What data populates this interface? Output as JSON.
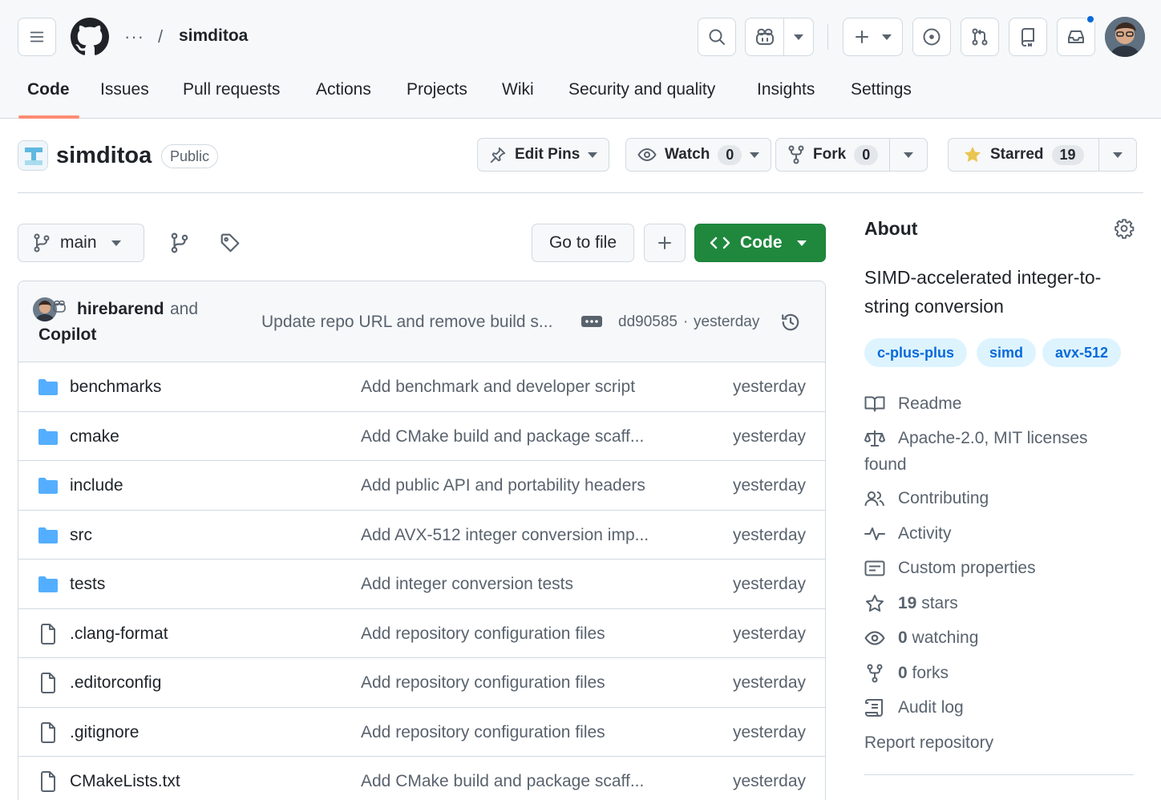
{
  "header": {
    "breadcrumb_dots": "···",
    "separator": "/",
    "repo_name": "simditoa"
  },
  "nav": {
    "tabs": [
      {
        "label": "Code"
      },
      {
        "label": "Issues"
      },
      {
        "label": "Pull requests"
      },
      {
        "label": "Actions"
      },
      {
        "label": "Projects"
      },
      {
        "label": "Wiki"
      },
      {
        "label": "Security and quality"
      },
      {
        "label": "Insights"
      },
      {
        "label": "Settings"
      }
    ]
  },
  "repo": {
    "name": "simditoa",
    "visibility": "Public",
    "edit_pins": "Edit Pins",
    "watch_label": "Watch",
    "watch_count": "0",
    "fork_label": "Fork",
    "fork_count": "0",
    "star_label": "Starred",
    "star_count": "19"
  },
  "toolbar": {
    "branch": "main",
    "go_to_file": "Go to file",
    "add": "+",
    "code": "Code"
  },
  "commit": {
    "author": "hirebarend",
    "and": "and",
    "coauthor": "Copilot",
    "message": "Update repo URL and remove build s...",
    "hash": "dd90585",
    "dot": "·",
    "time": "yesterday"
  },
  "files": [
    {
      "type": "folder",
      "name": "benchmarks",
      "message": "Add benchmark and developer script",
      "time": "yesterday"
    },
    {
      "type": "folder",
      "name": "cmake",
      "message": "Add CMake build and package scaff...",
      "time": "yesterday"
    },
    {
      "type": "folder",
      "name": "include",
      "message": "Add public API and portability headers",
      "time": "yesterday"
    },
    {
      "type": "folder",
      "name": "src",
      "message": "Add AVX-512 integer conversion imp...",
      "time": "yesterday"
    },
    {
      "type": "folder",
      "name": "tests",
      "message": "Add integer conversion tests",
      "time": "yesterday"
    },
    {
      "type": "file",
      "name": ".clang-format",
      "message": "Add repository configuration files",
      "time": "yesterday"
    },
    {
      "type": "file",
      "name": ".editorconfig",
      "message": "Add repository configuration files",
      "time": "yesterday"
    },
    {
      "type": "file",
      "name": ".gitignore",
      "message": "Add repository configuration files",
      "time": "yesterday"
    },
    {
      "type": "file",
      "name": "CMakeLists.txt",
      "message": "Add CMake build and package scaff...",
      "time": "yesterday"
    }
  ],
  "about": {
    "title": "About",
    "description_line1": "SIMD-accelerated integer-to-",
    "description_line2": "string conversion",
    "topics": [
      "c-plus-plus",
      "simd",
      "avx-512"
    ],
    "readme": "Readme",
    "license_line1": "Apache-2.0, MIT licenses",
    "license_line2": "found",
    "contributing": "Contributing",
    "activity": "Activity",
    "custom_properties": "Custom properties",
    "stars_count": "19",
    "stars_label": "stars",
    "watching_count": "0",
    "watching_label": "watching",
    "forks_count": "0",
    "forks_label": "forks",
    "audit_log": "Audit log",
    "report": "Report repository"
  },
  "colors": {
    "primary_green": "#1f883d",
    "link_blue": "#0969da",
    "nav_underline": "#fd8c73",
    "folder_blue": "#54aeff",
    "star_yellow": "#eac54f"
  }
}
